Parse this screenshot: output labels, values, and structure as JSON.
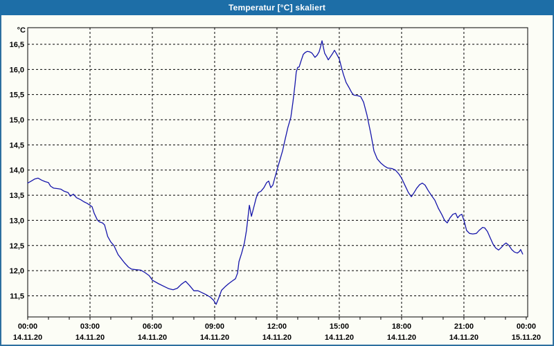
{
  "window": {
    "title": "Temperatur [°C] skaliert",
    "titlebar_color": "#1d6ea7",
    "border_color": "#2d6f9f",
    "background_color": "#fcfdf6"
  },
  "chart_data": {
    "type": "line",
    "title": "Temperatur [°C] skaliert",
    "y_unit_label": "°C",
    "series_name": "Temperatur",
    "series_color": "#1515aa",
    "grid": "dashed",
    "legend": "none",
    "ylim": [
      11.08,
      16.83
    ],
    "xlim_hours": [
      0,
      24.07
    ],
    "y_ticks": [
      {
        "value": 16.5,
        "label": "16,5"
      },
      {
        "value": 16.0,
        "label": "16,0"
      },
      {
        "value": 15.5,
        "label": "15,5"
      },
      {
        "value": 15.0,
        "label": "15,0"
      },
      {
        "value": 14.5,
        "label": "14,5"
      },
      {
        "value": 14.0,
        "label": "14,0"
      },
      {
        "value": 13.5,
        "label": "13,5"
      },
      {
        "value": 13.0,
        "label": "13,0"
      },
      {
        "value": 12.5,
        "label": "12,5"
      },
      {
        "value": 12.0,
        "label": "12,0"
      },
      {
        "value": 11.5,
        "label": "11,5"
      }
    ],
    "x_ticks": [
      {
        "hour": 0,
        "time": "00:00",
        "date": "14.11.20",
        "gridline": false
      },
      {
        "hour": 3,
        "time": "03:00",
        "date": "14.11.20",
        "gridline": true
      },
      {
        "hour": 6,
        "time": "06:00",
        "date": "14.11.20",
        "gridline": true
      },
      {
        "hour": 9,
        "time": "09:00",
        "date": "14.11.20",
        "gridline": true
      },
      {
        "hour": 12,
        "time": "12:00",
        "date": "14.11.20",
        "gridline": true
      },
      {
        "hour": 15,
        "time": "15:00",
        "date": "14.11.20",
        "gridline": true
      },
      {
        "hour": 18,
        "time": "18:00",
        "date": "14.11.20",
        "gridline": true
      },
      {
        "hour": 21,
        "time": "21:00",
        "date": "14.11.20",
        "gridline": true
      },
      {
        "hour": 24,
        "time": "00:00",
        "date": "15.11.20",
        "gridline": false
      }
    ],
    "minor_x_tick_every_hours": 1,
    "points": [
      [
        0.0,
        13.74
      ],
      [
        0.17,
        13.78
      ],
      [
        0.33,
        13.82
      ],
      [
        0.5,
        13.84
      ],
      [
        0.67,
        13.8
      ],
      [
        0.83,
        13.77
      ],
      [
        1.0,
        13.75
      ],
      [
        1.1,
        13.68
      ],
      [
        1.25,
        13.64
      ],
      [
        1.45,
        13.63
      ],
      [
        1.6,
        13.62
      ],
      [
        1.75,
        13.58
      ],
      [
        1.95,
        13.55
      ],
      [
        2.05,
        13.48
      ],
      [
        2.2,
        13.52
      ],
      [
        2.35,
        13.45
      ],
      [
        2.55,
        13.41
      ],
      [
        2.7,
        13.37
      ],
      [
        2.85,
        13.34
      ],
      [
        3.0,
        13.3
      ],
      [
        3.1,
        13.27
      ],
      [
        3.2,
        13.14
      ],
      [
        3.35,
        13.01
      ],
      [
        3.45,
        12.97
      ],
      [
        3.6,
        12.95
      ],
      [
        3.7,
        12.91
      ],
      [
        3.85,
        12.68
      ],
      [
        4.0,
        12.57
      ],
      [
        4.15,
        12.5
      ],
      [
        4.35,
        12.32
      ],
      [
        4.5,
        12.24
      ],
      [
        4.65,
        12.16
      ],
      [
        4.85,
        12.07
      ],
      [
        5.0,
        12.03
      ],
      [
        5.2,
        12.02
      ],
      [
        5.45,
        12.01
      ],
      [
        5.65,
        11.96
      ],
      [
        5.85,
        11.9
      ],
      [
        6.0,
        11.81
      ],
      [
        6.3,
        11.74
      ],
      [
        6.6,
        11.68
      ],
      [
        6.8,
        11.64
      ],
      [
        7.0,
        11.62
      ],
      [
        7.2,
        11.65
      ],
      [
        7.4,
        11.73
      ],
      [
        7.6,
        11.79
      ],
      [
        7.8,
        11.7
      ],
      [
        8.0,
        11.6
      ],
      [
        8.2,
        11.6
      ],
      [
        8.4,
        11.56
      ],
      [
        8.6,
        11.52
      ],
      [
        8.8,
        11.47
      ],
      [
        8.95,
        11.41
      ],
      [
        9.07,
        11.33
      ],
      [
        9.2,
        11.46
      ],
      [
        9.33,
        11.61
      ],
      [
        9.5,
        11.68
      ],
      [
        9.67,
        11.74
      ],
      [
        9.83,
        11.79
      ],
      [
        10.0,
        11.84
      ],
      [
        10.1,
        11.95
      ],
      [
        10.17,
        12.18
      ],
      [
        10.3,
        12.35
      ],
      [
        10.43,
        12.55
      ],
      [
        10.53,
        12.8
      ],
      [
        10.6,
        13.05
      ],
      [
        10.67,
        13.3
      ],
      [
        10.77,
        13.08
      ],
      [
        10.87,
        13.24
      ],
      [
        11.0,
        13.45
      ],
      [
        11.1,
        13.55
      ],
      [
        11.23,
        13.58
      ],
      [
        11.37,
        13.65
      ],
      [
        11.5,
        13.75
      ],
      [
        11.6,
        13.78
      ],
      [
        11.7,
        13.65
      ],
      [
        11.8,
        13.7
      ],
      [
        11.9,
        13.85
      ],
      [
        12.0,
        14.0
      ],
      [
        12.13,
        14.18
      ],
      [
        12.27,
        14.38
      ],
      [
        12.4,
        14.62
      ],
      [
        12.53,
        14.85
      ],
      [
        12.67,
        15.05
      ],
      [
        12.77,
        15.35
      ],
      [
        12.87,
        15.7
      ],
      [
        12.93,
        15.95
      ],
      [
        13.0,
        16.04
      ],
      [
        13.07,
        16.05
      ],
      [
        13.17,
        16.18
      ],
      [
        13.27,
        16.3
      ],
      [
        13.37,
        16.34
      ],
      [
        13.47,
        16.36
      ],
      [
        13.57,
        16.35
      ],
      [
        13.67,
        16.33
      ],
      [
        13.73,
        16.3
      ],
      [
        13.83,
        16.24
      ],
      [
        13.93,
        16.28
      ],
      [
        14.03,
        16.35
      ],
      [
        14.1,
        16.45
      ],
      [
        14.17,
        16.57
      ],
      [
        14.23,
        16.45
      ],
      [
        14.3,
        16.32
      ],
      [
        14.4,
        16.25
      ],
      [
        14.47,
        16.19
      ],
      [
        14.57,
        16.25
      ],
      [
        14.67,
        16.31
      ],
      [
        14.77,
        16.38
      ],
      [
        14.87,
        16.31
      ],
      [
        15.0,
        16.21
      ],
      [
        15.1,
        16.05
      ],
      [
        15.2,
        15.9
      ],
      [
        15.33,
        15.74
      ],
      [
        15.47,
        15.64
      ],
      [
        15.6,
        15.54
      ],
      [
        15.7,
        15.49
      ],
      [
        15.87,
        15.48
      ],
      [
        16.03,
        15.46
      ],
      [
        16.17,
        15.35
      ],
      [
        16.33,
        15.1
      ],
      [
        16.43,
        14.9
      ],
      [
        16.53,
        14.7
      ],
      [
        16.67,
        14.38
      ],
      [
        16.83,
        14.22
      ],
      [
        17.0,
        14.14
      ],
      [
        17.17,
        14.08
      ],
      [
        17.33,
        14.04
      ],
      [
        17.53,
        14.03
      ],
      [
        17.7,
        14.0
      ],
      [
        17.87,
        13.92
      ],
      [
        18.0,
        13.84
      ],
      [
        18.17,
        13.69
      ],
      [
        18.33,
        13.55
      ],
      [
        18.47,
        13.47
      ],
      [
        18.6,
        13.55
      ],
      [
        18.73,
        13.64
      ],
      [
        18.87,
        13.71
      ],
      [
        19.0,
        13.74
      ],
      [
        19.13,
        13.7
      ],
      [
        19.27,
        13.6
      ],
      [
        19.43,
        13.5
      ],
      [
        19.6,
        13.4
      ],
      [
        19.77,
        13.24
      ],
      [
        19.93,
        13.12
      ],
      [
        20.07,
        13.0
      ],
      [
        20.2,
        12.95
      ],
      [
        20.33,
        13.05
      ],
      [
        20.47,
        13.12
      ],
      [
        20.6,
        13.14
      ],
      [
        20.7,
        13.05
      ],
      [
        20.8,
        13.1
      ],
      [
        20.9,
        13.12
      ],
      [
        21.0,
        13.0
      ],
      [
        21.13,
        12.8
      ],
      [
        21.27,
        12.74
      ],
      [
        21.43,
        12.73
      ],
      [
        21.6,
        12.74
      ],
      [
        21.73,
        12.8
      ],
      [
        21.9,
        12.86
      ],
      [
        22.0,
        12.85
      ],
      [
        22.13,
        12.78
      ],
      [
        22.27,
        12.65
      ],
      [
        22.4,
        12.53
      ],
      [
        22.53,
        12.45
      ],
      [
        22.67,
        12.41
      ],
      [
        22.8,
        12.46
      ],
      [
        22.93,
        12.52
      ],
      [
        23.03,
        12.55
      ],
      [
        23.17,
        12.5
      ],
      [
        23.3,
        12.42
      ],
      [
        23.43,
        12.37
      ],
      [
        23.57,
        12.35
      ],
      [
        23.67,
        12.38
      ],
      [
        23.73,
        12.42
      ],
      [
        23.83,
        12.33
      ]
    ]
  }
}
